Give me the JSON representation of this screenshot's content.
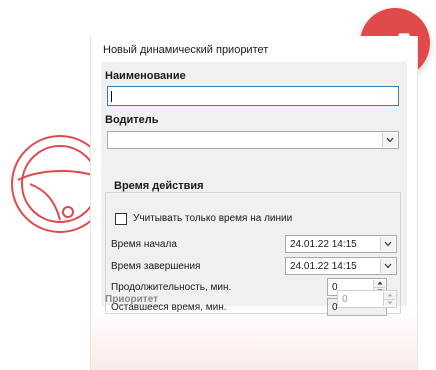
{
  "decor": {
    "wheel_icon": "steering-wheel-icon",
    "badge_icon": "trend-up-icon",
    "accent": "#e04a4a"
  },
  "dialog": {
    "title": "Новый динамический приоритет",
    "name_label": "Наименование",
    "name_value": "",
    "driver_label": "Водитель",
    "driver_value": "",
    "time_group_title": "Время действия",
    "only_line_time_label": "Учитывать только время на линии",
    "only_line_time_checked": false,
    "start_label": "Время начала",
    "start_value": "24.01.22 14:15",
    "end_label": "Время завершения",
    "end_value": "24.01.22 14:15",
    "duration_label": "Продолжительность, мин.",
    "duration_value": "0",
    "remaining_label": "Оставшееся время, мин.",
    "remaining_value": "0",
    "priority_label": "Приоритет",
    "priority_value": "0"
  }
}
